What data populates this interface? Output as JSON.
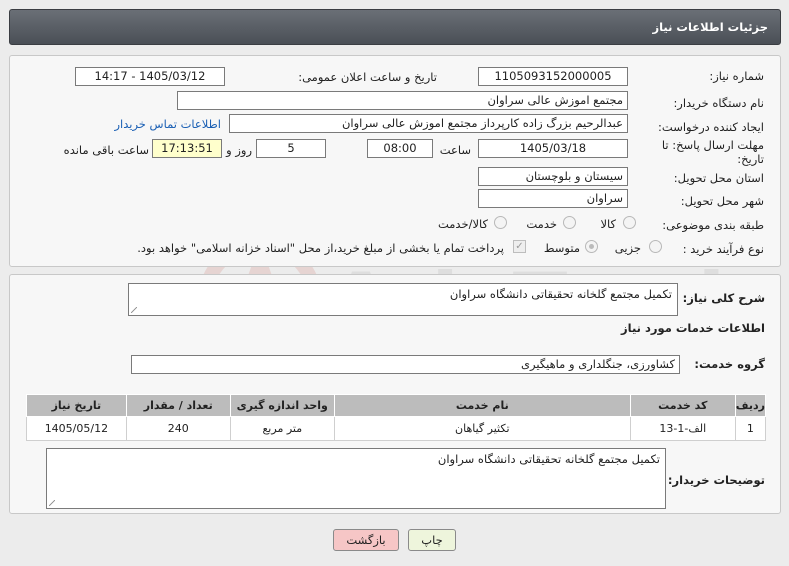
{
  "header": {
    "title": "جزئیات اطلاعات نیاز"
  },
  "form": {
    "need_number_label": "شماره نیاز:",
    "need_number": "1105093152000005",
    "announce_label": "تاریخ و ساعت اعلان عمومی:",
    "announce_value": "1405/03/12 - 14:17",
    "buyer_org_label": "نام دستگاه خریدار:",
    "buyer_org": "مجتمع اموزش عالی سراوان",
    "creator_label": "ایجاد کننده درخواست:",
    "creator": "عبدالرحیم بزرگ زاده کارپرداز مجتمع اموزش عالی سراوان",
    "contact_link": "اطلاعات تماس خریدار",
    "deadline_label": "مهلت ارسال پاسخ: تا تاریخ:",
    "deadline_date": "1405/03/18",
    "time_label": "ساعت",
    "deadline_time": "08:00",
    "days_value": "5",
    "days_label": "روز و",
    "remaining_time": "17:13:51",
    "remaining_label": "ساعت باقی مانده",
    "province_label": "استان محل تحویل:",
    "province": "سیستان و بلوچستان",
    "city_label": "شهر محل تحویل:",
    "city": "سراوان",
    "category_label": "طبقه بندی موضوعی:",
    "category_options": [
      "کالا",
      "خدمت",
      "کالا/خدمت"
    ],
    "process_label": "نوع فرآیند خرید :",
    "process_options": [
      "جزیی",
      "متوسط"
    ],
    "payment_note": "پرداخت تمام یا بخشی از مبلغ خرید،از محل \"اسناد خزانه اسلامی\" خواهد بود."
  },
  "summary": {
    "label": "شرح کلی نیاز:",
    "text": "تکمیل مجتمع گلخانه تحقیقاتی دانشگاه سراوان"
  },
  "services": {
    "section_title": "اطلاعات خدمات مورد نیاز",
    "group_label": "گروه خدمت:",
    "group_value": "کشاورزی، جنگلداری و ماهیگیری",
    "columns": [
      "ردیف",
      "کد خدمت",
      "نام خدمت",
      "واحد اندازه گیری",
      "تعداد / مقدار",
      "تاریخ نیاز"
    ],
    "rows": [
      [
        "1",
        "الف-1-13",
        "تکثیر گیاهان",
        "متر مربع",
        "240",
        "1405/05/12"
      ]
    ]
  },
  "buyer_notes": {
    "label": "توضیحات خریدار:",
    "text": "تکمیل مجتمع گلخانه تحقیقاتی دانشگاه سراوان"
  },
  "buttons": {
    "print": "چاپ",
    "back": "بازگشت"
  },
  "watermark_text": "AriaTender.net",
  "colors": {
    "accent": "#1a5fb4",
    "back_button": "#f6c6c6",
    "print_button": "#eef5dc",
    "header": "#555a61"
  }
}
